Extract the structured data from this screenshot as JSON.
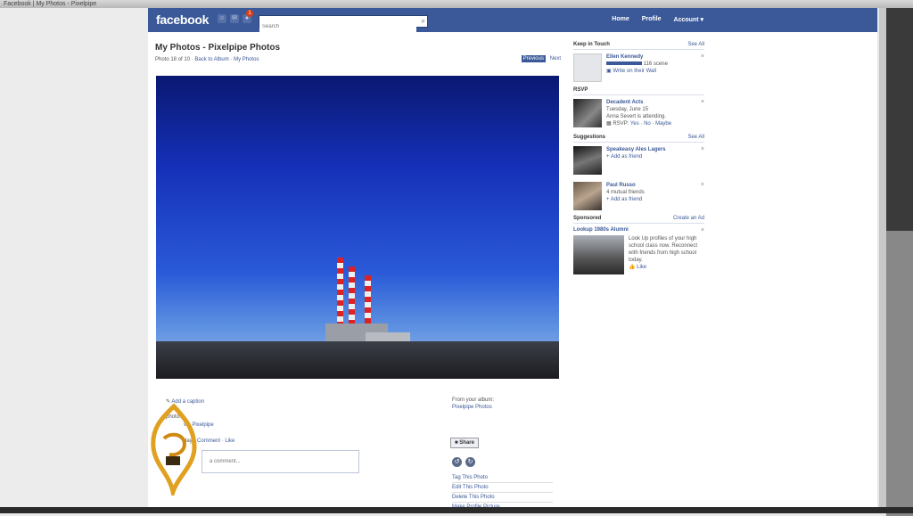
{
  "window": {
    "title": "Facebook | My Photos - Pixelpipe"
  },
  "nav": {
    "logo": "facebook",
    "search_placeholder": "Search",
    "notification_count": "1",
    "links": [
      "Home",
      "Profile",
      "Account ▾"
    ]
  },
  "photo_page": {
    "title": "My Photos - Pixelpipe Photos",
    "counter": "Photo 18 of 10",
    "back_link": "Back to Album",
    "my_photos_link": "My Photos",
    "prev": "Previous",
    "next": "Next",
    "add_caption": "Add a caption",
    "photo_prefix": "photo:",
    "via": "via Pixelpipe",
    "time_link": "day",
    "comment_link": "Comment",
    "like_link": "Like",
    "comment_placeholder": "a comment...",
    "from_album_label": "From your album:",
    "album_name": "Pixelpipe Photos",
    "share": "Share",
    "actions": [
      "Tag This Photo",
      "Edit This Photo",
      "Delete This Photo",
      "Make Profile Picture"
    ]
  },
  "sidebar": {
    "keep_in_touch": {
      "title": "Keep in Touch",
      "see_all": "See All",
      "name": "Ellen Kennedy",
      "meta": "116 scene",
      "action": "Write on their Wall"
    },
    "rsvp": {
      "title": "RSVP",
      "event": "Decadent Acts",
      "date": "Tuesday, June 15",
      "attending": "Anna Severt is attending.",
      "rsvp_prefix": "RSVP:",
      "yes": "Yes",
      "no": "No",
      "maybe": "Maybe"
    },
    "suggestions": {
      "title": "Suggestions",
      "see_all": "See All",
      "items": [
        {
          "name": "Speakeasy Ales Lagers",
          "meta": "",
          "action": "Add as friend"
        },
        {
          "name": "Paul Russo",
          "meta": "4 mutual friends",
          "action": "Add as friend"
        }
      ]
    },
    "sponsored": {
      "title": "Sponsored",
      "create": "Create an Ad",
      "ad_title": "Lookup 1980s Alumni",
      "ad_text": "Look Up profiles of your high school class now. Reconnect with friends from high school today.",
      "like": "Like"
    }
  },
  "colors": {
    "fb_blue": "#3b5998",
    "link": "#3b5998",
    "photo_sky": "#1530b8"
  }
}
